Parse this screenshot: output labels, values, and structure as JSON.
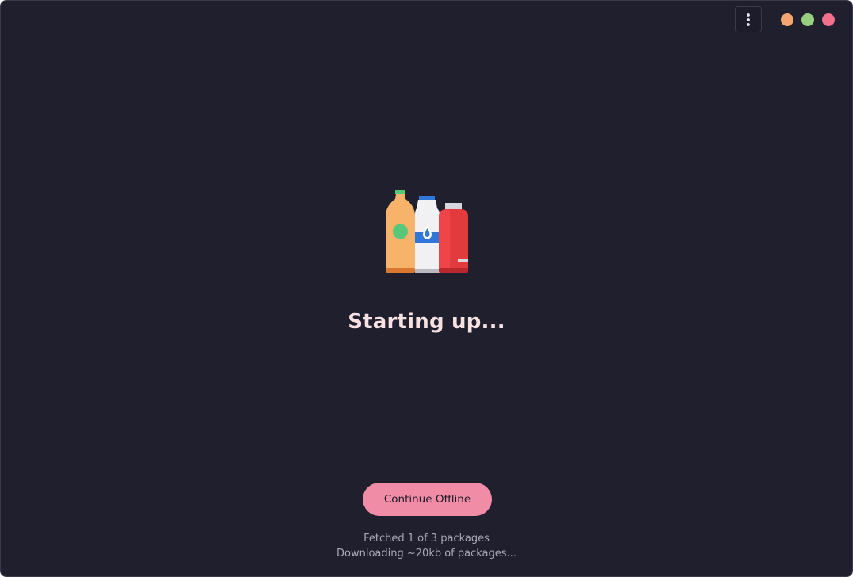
{
  "window": {
    "menu_icon": "vertical-dots-icon",
    "controls": [
      {
        "name": "minimize",
        "color": "#f5a56d"
      },
      {
        "name": "maximize",
        "color": "#99d080"
      },
      {
        "name": "close",
        "color": "#f2708c"
      }
    ]
  },
  "splash": {
    "illustration": "bottles-logo-icon",
    "title": "Starting up...",
    "button_label": "Continue Offline",
    "status_lines": [
      "Fetched 1 of 3 packages",
      "Downloading ~20kb of packages..."
    ]
  },
  "colors": {
    "background": "#1f1f2e",
    "accent": "#f08ca6",
    "title": "#f7e1e1",
    "muted_text": "#a9a9b6"
  }
}
